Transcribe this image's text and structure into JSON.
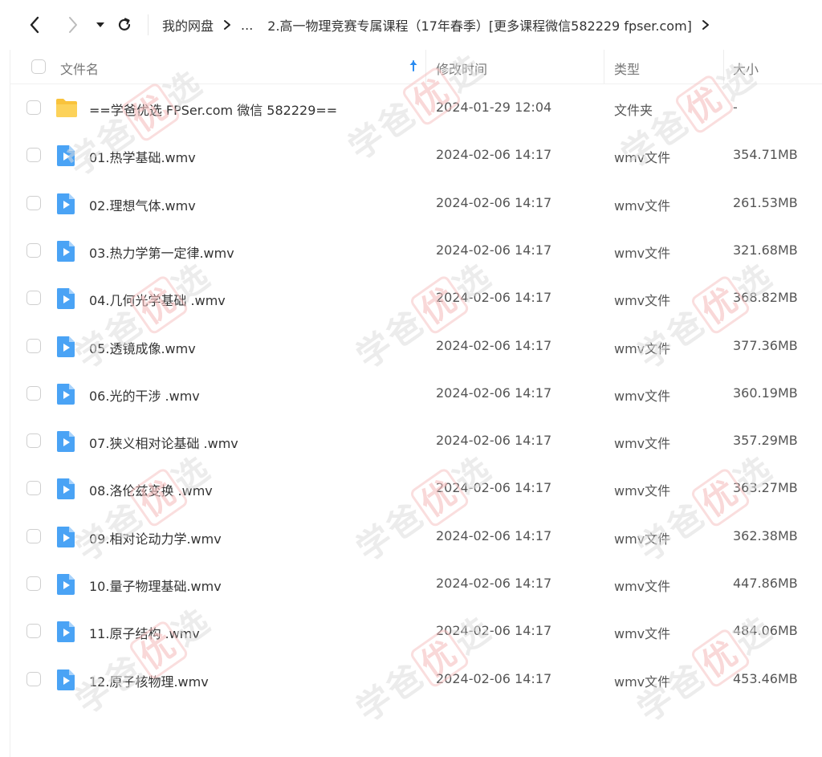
{
  "breadcrumb": {
    "root": "我的网盘",
    "ellipsis": "...",
    "current": "2.高一物理竞赛专属课程（17年春季）[更多课程微信582229 fpser.com]"
  },
  "columns": {
    "name": "文件名",
    "modified": "修改时间",
    "type": "类型",
    "size": "大小"
  },
  "watermark": {
    "xue": "学",
    "ba": "爸",
    "you": "优",
    "xuan": "选"
  },
  "files": [
    {
      "name": "==学爸优选 FPSer.com 微信 582229==",
      "modified": "2024-01-29 12:04",
      "type": "文件夹",
      "size": "-",
      "icon": "folder-icon"
    },
    {
      "name": "01.热学基础.wmv",
      "modified": "2024-02-06 14:17",
      "type": "wmv文件",
      "size": "354.71MB",
      "icon": "video-file-icon"
    },
    {
      "name": "02.理想气体.wmv",
      "modified": "2024-02-06 14:17",
      "type": "wmv文件",
      "size": "261.53MB",
      "icon": "video-file-icon"
    },
    {
      "name": "03.热力学第一定律.wmv",
      "modified": "2024-02-06 14:17",
      "type": "wmv文件",
      "size": "321.68MB",
      "icon": "video-file-icon"
    },
    {
      "name": "04.几何光学基础 .wmv",
      "modified": "2024-02-06 14:17",
      "type": "wmv文件",
      "size": "368.82MB",
      "icon": "video-file-icon"
    },
    {
      "name": "05.透镜成像.wmv",
      "modified": "2024-02-06 14:17",
      "type": "wmv文件",
      "size": "377.36MB",
      "icon": "video-file-icon"
    },
    {
      "name": "06.光的干涉 .wmv",
      "modified": "2024-02-06 14:17",
      "type": "wmv文件",
      "size": "360.19MB",
      "icon": "video-file-icon"
    },
    {
      "name": "07.狭义相对论基础 .wmv",
      "modified": "2024-02-06 14:17",
      "type": "wmv文件",
      "size": "357.29MB",
      "icon": "video-file-icon"
    },
    {
      "name": "08.洛伦兹变换 .wmv",
      "modified": "2024-02-06 14:17",
      "type": "wmv文件",
      "size": "363.27MB",
      "icon": "video-file-icon"
    },
    {
      "name": "09.相对论动力学.wmv",
      "modified": "2024-02-06 14:17",
      "type": "wmv文件",
      "size": "362.38MB",
      "icon": "video-file-icon"
    },
    {
      "name": "10.量子物理基础.wmv",
      "modified": "2024-02-06 14:17",
      "type": "wmv文件",
      "size": "447.86MB",
      "icon": "video-file-icon"
    },
    {
      "name": "11.原子结构 .wmv",
      "modified": "2024-02-06 14:17",
      "type": "wmv文件",
      "size": "484.06MB",
      "icon": "video-file-icon"
    },
    {
      "name": "12.原子核物理.wmv",
      "modified": "2024-02-06 14:17",
      "type": "wmv文件",
      "size": "453.46MB",
      "icon": "video-file-icon"
    }
  ],
  "colors": {
    "accent": "#2b8cf0",
    "folder": "#f9c33c",
    "video": "#4aa3f5"
  }
}
